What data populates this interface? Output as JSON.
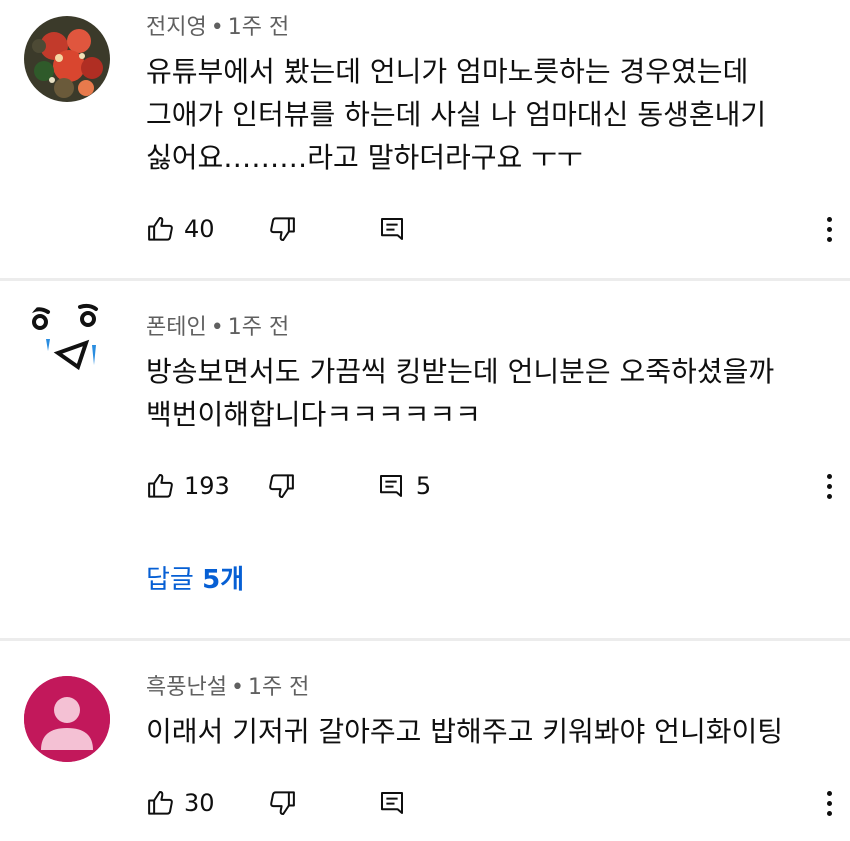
{
  "comments": [
    {
      "author": "전지영",
      "time": "1주 전",
      "text": "유튜부에서 봤는데 언니가 엄마노릇하는 경우였는데\n그애가 인터뷰를 하는데 사실 나 엄마대신 동생혼내기\n싫어요………라고 말하더라구요 ㅜㅜ",
      "likes": "40",
      "reply_count": ""
    },
    {
      "author": "폰테인",
      "time": "1주 전",
      "text": "방송보면서도 가끔씩 킹받는데 언니분은 오죽하셨을까\n백번이해합니다ㅋㅋㅋㅋㅋㅋ",
      "likes": "193",
      "reply_count": "5",
      "replies_prefix": "답글",
      "replies_count_label": "5개"
    },
    {
      "author": "흑풍난설",
      "time": "1주 전",
      "text": "이래서 기저귀 갈아주고 밥해주고 키워봐야 언니화이팅",
      "likes": "30",
      "reply_count": ""
    }
  ],
  "separator": "•",
  "icons": {
    "like": "thumb-up-icon",
    "dislike": "thumb-down-icon",
    "reply": "comment-icon",
    "more": "more-vert-icon"
  },
  "colors": {
    "link": "#065fd4",
    "avatar_pink": "#c2185b",
    "divider": "#ececec"
  }
}
